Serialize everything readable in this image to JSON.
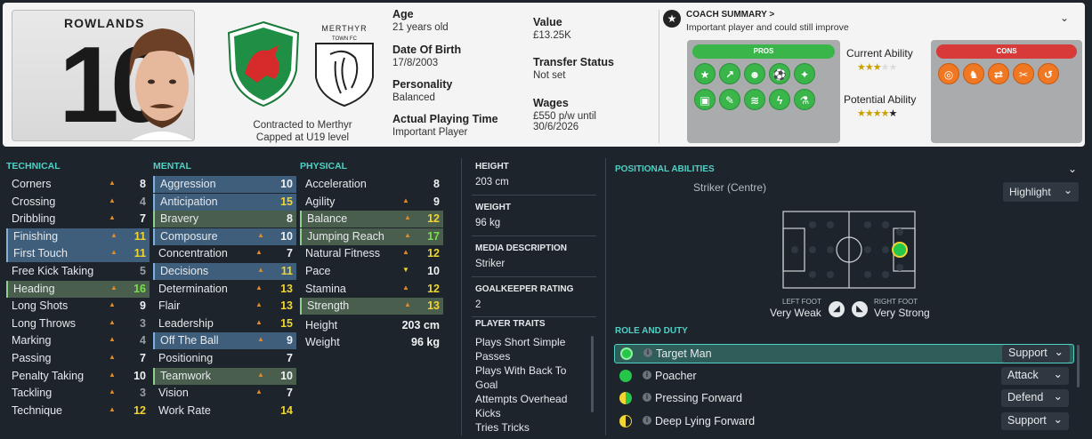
{
  "player": {
    "surname": "ROWLANDS",
    "number": "10"
  },
  "contract": {
    "line1": "Contracted to Merthyr",
    "line2": "Capped at U19 level"
  },
  "club": {
    "crest_line1": "MERTHYR",
    "crest_line2": "TOWN FC"
  },
  "info": {
    "age_label": "Age",
    "age_value": "21 years old",
    "dob_label": "Date Of Birth",
    "dob_value": "17/8/2003",
    "personality_label": "Personality",
    "personality_value": "Balanced",
    "apt_label": "Actual Playing Time",
    "apt_value": "Important Player",
    "value_label": "Value",
    "value_value": "£13.25K",
    "transfer_label": "Transfer Status",
    "transfer_value": "Not set",
    "wages_label": "Wages",
    "wages_value": "£550 p/w until",
    "wages_until": "30/6/2026"
  },
  "coach": {
    "title": "COACH SUMMARY >",
    "subtitle": "Important player and could still improve"
  },
  "pros": {
    "label": "PROS"
  },
  "cons": {
    "label": "CONS"
  },
  "ability": {
    "current_label": "Current Ability",
    "potential_label": "Potential Ability",
    "current_stars": 3,
    "potential_stars": 5
  },
  "technical": {
    "heading": "TECHNICAL",
    "rows": [
      {
        "name": "Corners",
        "value": "8"
      },
      {
        "name": "Crossing",
        "value": "4"
      },
      {
        "name": "Dribbling",
        "value": "7"
      },
      {
        "name": "Finishing",
        "value": "11"
      },
      {
        "name": "First Touch",
        "value": "11"
      },
      {
        "name": "Free Kick Taking",
        "value": "5"
      },
      {
        "name": "Heading",
        "value": "16"
      },
      {
        "name": "Long Shots",
        "value": "9"
      },
      {
        "name": "Long Throws",
        "value": "3"
      },
      {
        "name": "Marking",
        "value": "4"
      },
      {
        "name": "Passing",
        "value": "7"
      },
      {
        "name": "Penalty Taking",
        "value": "10"
      },
      {
        "name": "Tackling",
        "value": "3"
      },
      {
        "name": "Technique",
        "value": "12"
      }
    ]
  },
  "mental": {
    "heading": "MENTAL",
    "rows": [
      {
        "name": "Aggression",
        "value": "10"
      },
      {
        "name": "Anticipation",
        "value": "15"
      },
      {
        "name": "Bravery",
        "value": "8"
      },
      {
        "name": "Composure",
        "value": "10"
      },
      {
        "name": "Concentration",
        "value": "7"
      },
      {
        "name": "Decisions",
        "value": "11"
      },
      {
        "name": "Determination",
        "value": "13"
      },
      {
        "name": "Flair",
        "value": "13"
      },
      {
        "name": "Leadership",
        "value": "15"
      },
      {
        "name": "Off The Ball",
        "value": "9"
      },
      {
        "name": "Positioning",
        "value": "7"
      },
      {
        "name": "Teamwork",
        "value": "10"
      },
      {
        "name": "Vision",
        "value": "7"
      },
      {
        "name": "Work Rate",
        "value": "14"
      }
    ]
  },
  "physical": {
    "heading": "PHYSICAL",
    "rows": [
      {
        "name": "Acceleration",
        "value": "8"
      },
      {
        "name": "Agility",
        "value": "9"
      },
      {
        "name": "Balance",
        "value": "12"
      },
      {
        "name": "Jumping Reach",
        "value": "17"
      },
      {
        "name": "Natural Fitness",
        "value": "12"
      },
      {
        "name": "Pace",
        "value": "10"
      },
      {
        "name": "Stamina",
        "value": "12"
      },
      {
        "name": "Strength",
        "value": "13"
      }
    ],
    "height_label": "Height",
    "height_value": "203 cm",
    "weight_label": "Weight",
    "weight_value": "96 kg"
  },
  "details": {
    "height_h": "HEIGHT",
    "height_v": "203 cm",
    "weight_h": "WEIGHT",
    "weight_v": "96 kg",
    "media_h": "MEDIA DESCRIPTION",
    "media_v": "Striker",
    "gk_h": "GOALKEEPER RATING",
    "gk_v": "2",
    "traits_h": "PLAYER TRAITS",
    "traits": [
      "Plays Short Simple",
      "Passes",
      "Plays With Back To",
      "Goal",
      "Attempts Overhead",
      "Kicks",
      "Tries Tricks"
    ]
  },
  "positional": {
    "heading": "POSITIONAL ABILITIES",
    "position": "Striker (Centre)",
    "highlight": "Highlight",
    "left_foot_label": "LEFT FOOT",
    "left_foot_value": "Very Weak",
    "right_foot_label": "RIGHT FOOT",
    "right_foot_value": "Very Strong"
  },
  "roles": {
    "heading": "ROLE AND DUTY",
    "items": [
      {
        "name": "Target Man",
        "duty": "Support"
      },
      {
        "name": "Poacher",
        "duty": "Attack"
      },
      {
        "name": "Pressing Forward",
        "duty": "Defend"
      },
      {
        "name": "Deep Lying Forward",
        "duty": "Support"
      }
    ]
  },
  "colors": {
    "accent": "#4fd1c5",
    "pros": "#39b54a",
    "cons": "#d83a3a",
    "trait_orange": "#f07822"
  }
}
